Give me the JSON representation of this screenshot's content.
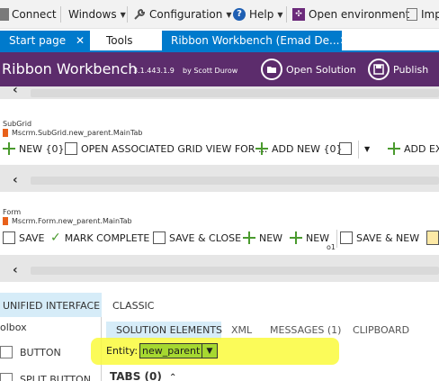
{
  "menubar": {
    "items": [
      {
        "label": "Connect",
        "icon": "connect-icon"
      },
      {
        "label": "Windows",
        "icon": ""
      },
      {
        "label": "Configuration",
        "icon": "wrench-icon"
      },
      {
        "label": "Help",
        "icon": "help-icon"
      },
      {
        "label": "Open environment",
        "icon": "dynamics-icon"
      },
      {
        "label": "Imp",
        "icon": "import-icon"
      }
    ]
  },
  "doc_tabs": [
    {
      "label": "Start page"
    },
    {
      "label": "Tools"
    },
    {
      "label": "Ribbon Workbench (Emad De..."
    }
  ],
  "header": {
    "title": "Ribbon Workbench",
    "version": "3.1.443.1.9",
    "author": "by Scott Durow",
    "open_solution": "Open Solution",
    "publish": "Publish"
  },
  "subgrid": {
    "label": "SubGrid",
    "tab_id": "Mscrm.SubGrid.new_parent.MainTab",
    "commands": [
      {
        "label": "NEW {0}"
      },
      {
        "label": "OPEN ASSOCIATED GRID VIEW FOR ..."
      },
      {
        "label": "ADD NEW {0}"
      },
      {
        "label": ""
      },
      {
        "label": "ADD EX"
      }
    ]
  },
  "form": {
    "label": "Form",
    "tab_id": "Mscrm.Form.new_parent.MainTab",
    "commands": [
      {
        "label": "SAVE"
      },
      {
        "label": "MARK COMPLETE"
      },
      {
        "label": "SAVE & CLOSE"
      },
      {
        "label": "NEW"
      },
      {
        "label": "NEW"
      },
      {
        "label": "SAVE & NEW"
      }
    ],
    "new_badge": "o1"
  },
  "ui_tabs": {
    "unified": "UNIFIED INTERFACE",
    "classic": "CLASSIC"
  },
  "toolbox": {
    "title": "olbox",
    "items": [
      {
        "label": "BUTTON"
      },
      {
        "label": "SPLIT BUTTON"
      }
    ]
  },
  "solution_tabs": [
    {
      "label": "SOLUTION ELEMENTS"
    },
    {
      "label": "XML"
    },
    {
      "label": "MESSAGES (1)"
    },
    {
      "label": "CLIPBOARD"
    }
  ],
  "entity": {
    "label": "Entity:",
    "value": "new_parent"
  },
  "tabs_section": {
    "label": "TABS (0)"
  },
  "colors": {
    "accent": "#007acc",
    "header_bg": "#5c2c6c",
    "highlight": "#fafa3c",
    "entity_select_bg": "#a6d830",
    "orange_marker": "#e8611b",
    "active_tab_bg": "#d6ecf8"
  }
}
